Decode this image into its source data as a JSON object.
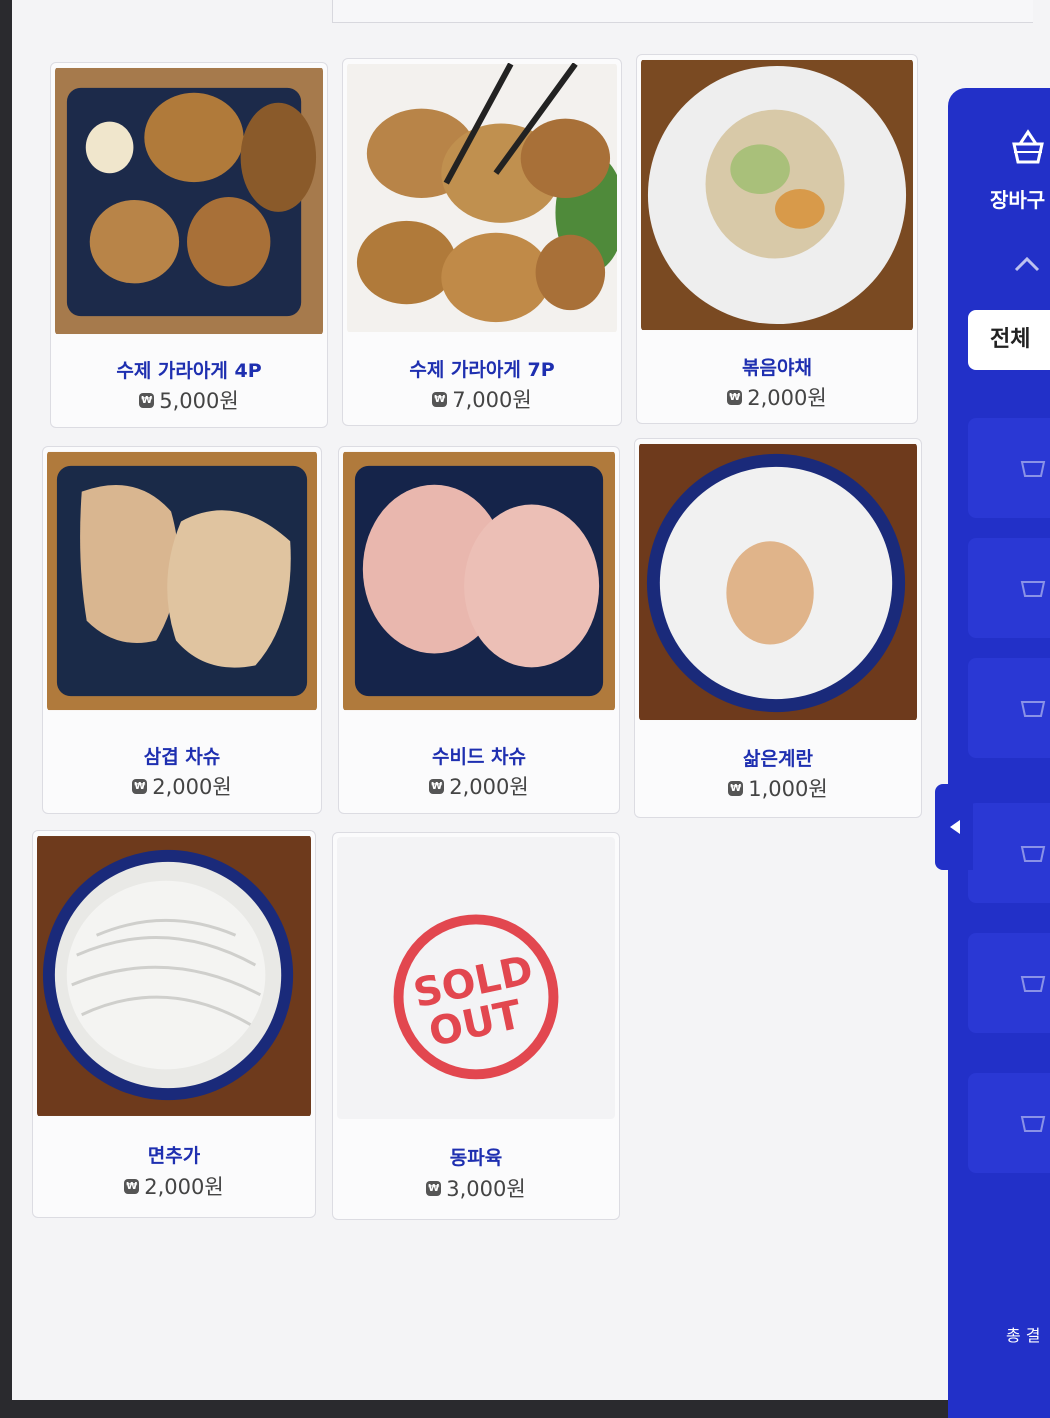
{
  "menu": {
    "items": [
      {
        "name": "수제 가라아게 4P",
        "price": "5,000원",
        "image": "karaage-4p"
      },
      {
        "name": "수제 가라아게 7P",
        "price": "7,000원",
        "image": "karaage-7p"
      },
      {
        "name": "볶음야채",
        "price": "2,000원",
        "image": "stir-fried-vegetables"
      },
      {
        "name": "삼겹 차슈",
        "price": "2,000원",
        "image": "pork-belly-chashu"
      },
      {
        "name": "수비드 차슈",
        "price": "2,000원",
        "image": "sous-vide-chashu"
      },
      {
        "name": "삶은계란",
        "price": "1,000원",
        "image": "boiled-egg"
      },
      {
        "name": "면추가",
        "price": "2,000원",
        "image": "extra-noodles"
      },
      {
        "name": "동파육",
        "price": "3,000원",
        "image": "sold-out-stamp",
        "sold_out": true
      }
    ],
    "currency_icon": "won-icon",
    "sold_out_stamp": {
      "line1": "SOLD",
      "line2": "OUT",
      "color": "#e2474f"
    }
  },
  "side_panel": {
    "cart_label": "장바구",
    "filter_label": "전체",
    "total_label": "총 결",
    "background": "#2230c8"
  }
}
